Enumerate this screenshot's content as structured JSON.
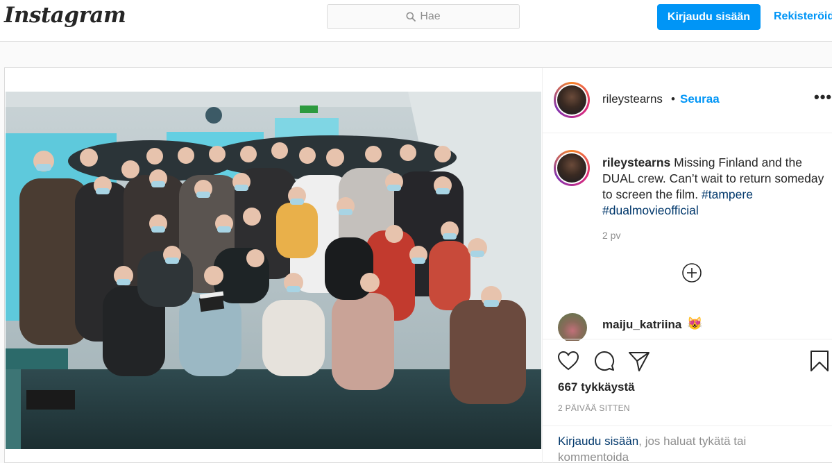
{
  "header": {
    "logo": "Instagram",
    "search_placeholder": "Hae",
    "login_button": "Kirjaudu sisään",
    "register_link": "Rekisteröidy"
  },
  "post": {
    "author": "rileystearns",
    "separator": "•",
    "follow": "Seuraa",
    "more_menu": "•••",
    "caption": {
      "username": "rileystearns",
      "text": "Missing Finland and the DUAL crew. Can’t wait to return someday to screen the film.",
      "hashtags": [
        "#tampere",
        "#dualmovieofficial"
      ]
    },
    "caption_age": "2 pv",
    "comments": [
      {
        "username": "maiju_katriina",
        "text": "😻"
      }
    ],
    "likes": "667 tykkäystä",
    "posted_ago": "2 PÄIVÄÄ SITTEN",
    "login_prompt": {
      "link": "Kirjaudu sisään",
      "text": ", jos haluat tykätä tai kommentoida"
    }
  },
  "icons": {
    "search": "search-icon",
    "like": "heart-icon",
    "comment": "comment-icon",
    "share": "share-icon",
    "save": "bookmark-icon",
    "load_more": "plus-circle-icon"
  },
  "colors": {
    "accent": "#0095f6",
    "hashtag": "#00376b",
    "muted": "#8e8e8e",
    "border": "#dbdbdb"
  }
}
